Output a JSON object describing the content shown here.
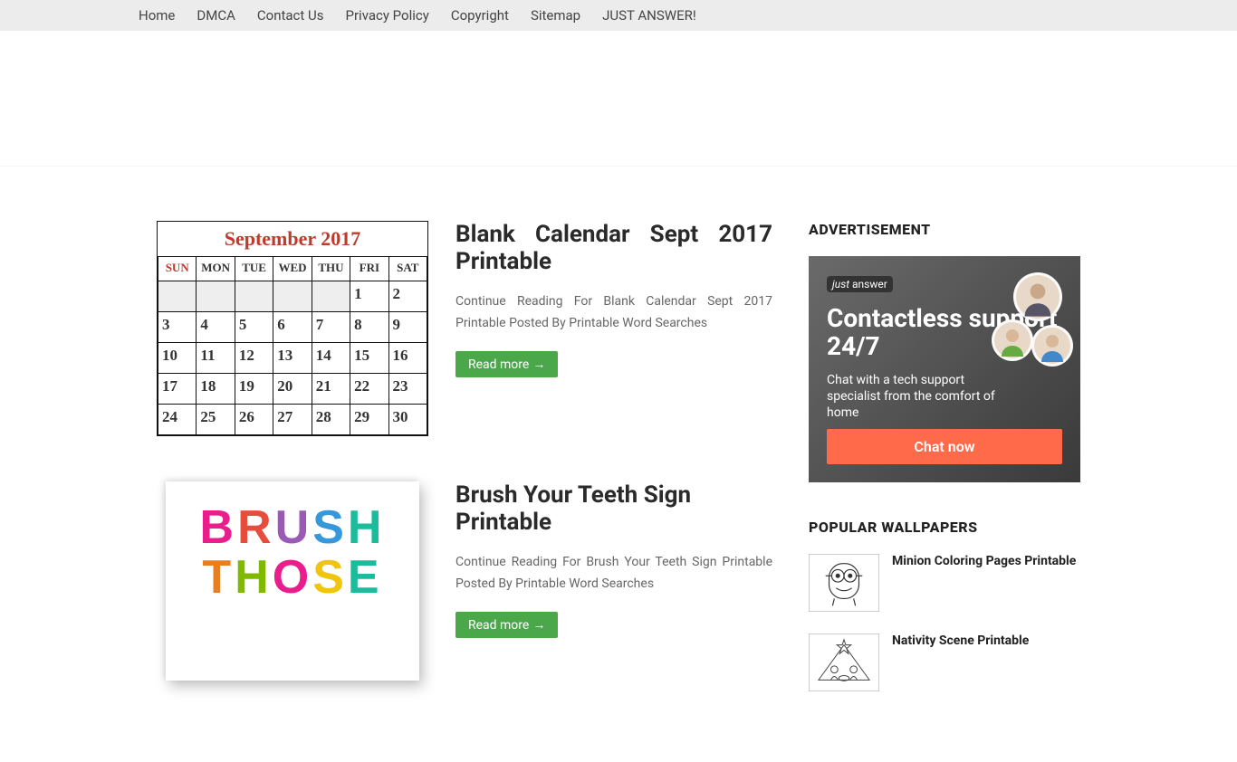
{
  "nav": {
    "items": [
      "Home",
      "DMCA",
      "Contact Us",
      "Privacy Policy",
      "Copyright",
      "Sitemap",
      "JUST ANSWER!"
    ]
  },
  "posts": [
    {
      "title": "Blank Calendar Sept 2017 Printable",
      "excerpt": "Continue Reading For Blank Calendar Sept 2017 Printable Posted By Printable Word Searches",
      "read_more": "Read more",
      "thumb_kind": "calendar"
    },
    {
      "title": "Brush Your Teeth Sign Printable",
      "excerpt": "Continue Reading For Brush Your Teeth Sign Printable Posted By Printable Word Searches",
      "read_more": "Read more",
      "thumb_kind": "brush"
    }
  ],
  "calendar": {
    "title": "September 2017",
    "dow": [
      "SUN",
      "MON",
      "TUE",
      "WED",
      "THU",
      "FRI",
      "SAT"
    ],
    "rows": [
      [
        "",
        "",
        "",
        "",
        "",
        "1",
        "2"
      ],
      [
        "3",
        "4",
        "5",
        "6",
        "7",
        "8",
        "9"
      ],
      [
        "10",
        "11",
        "12",
        "13",
        "14",
        "15",
        "16"
      ],
      [
        "17",
        "18",
        "19",
        "20",
        "21",
        "22",
        "23"
      ],
      [
        "24",
        "25",
        "26",
        "27",
        "28",
        "29",
        "30"
      ]
    ]
  },
  "brush": {
    "line1": [
      "B",
      "R",
      "U",
      "S",
      "H"
    ],
    "line2": [
      "T",
      "H",
      "O",
      "S",
      "E"
    ]
  },
  "sidebar": {
    "ad_heading": "ADVERTISEMENT",
    "ad": {
      "logo": "just answer",
      "title": "Contactless support 24/7",
      "subtitle": "Chat with a tech support specialist from the comfort of home",
      "cta": "Chat now"
    },
    "popular_heading": "POPULAR WALLPAPERS",
    "popular": [
      {
        "title": "Minion Coloring Pages Printable",
        "thumb": "minion"
      },
      {
        "title": "Nativity Scene Printable",
        "thumb": "nativity"
      }
    ]
  }
}
